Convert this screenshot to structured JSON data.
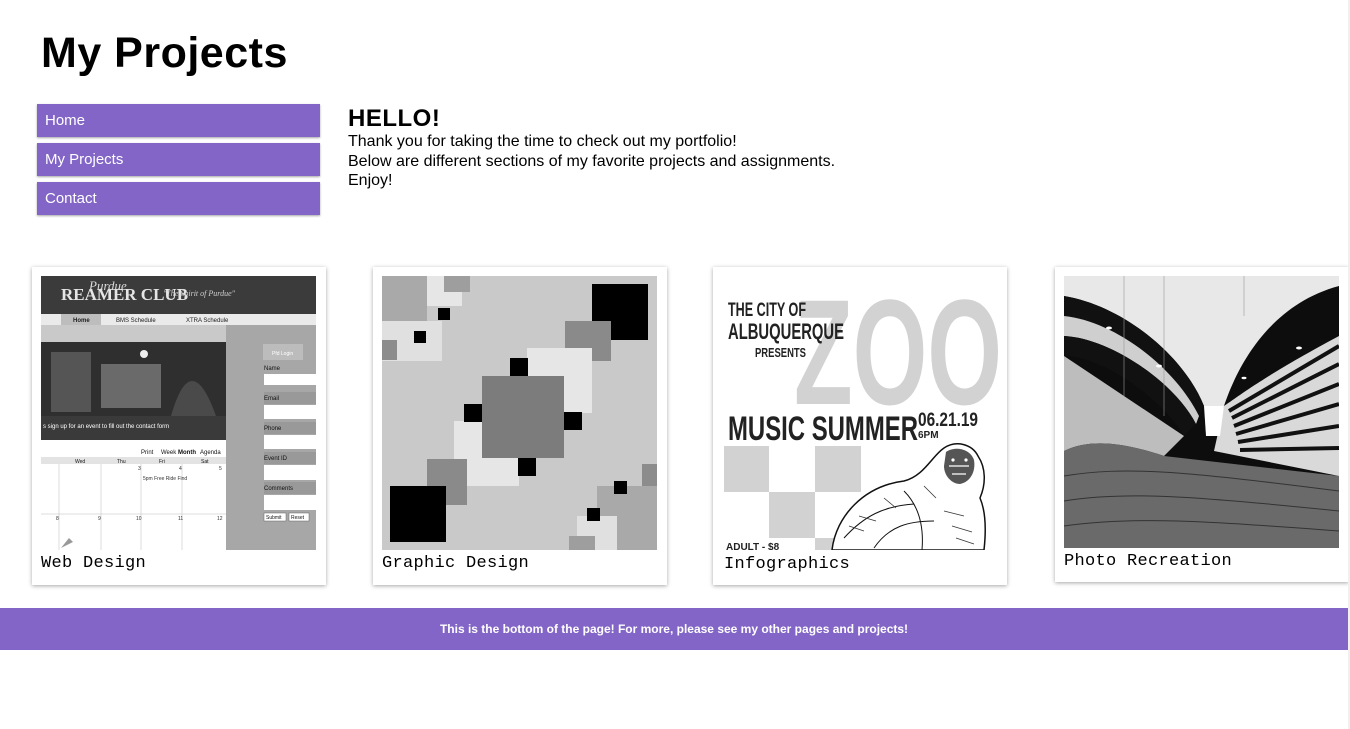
{
  "page": {
    "title": "My Projects"
  },
  "nav": {
    "items": [
      {
        "label": "Home"
      },
      {
        "label": "My Projects"
      },
      {
        "label": "Contact"
      }
    ]
  },
  "intro": {
    "heading": "HELLO!",
    "lines": [
      "Thank you for taking the time to check out my portfolio!",
      "Below are different sections of my favorite projects and assignments.",
      "Enjoy!"
    ]
  },
  "projects": [
    {
      "caption": "Web Design",
      "thumb": {
        "logo": "REAMER CLUB",
        "logo_script": "Purdue",
        "tagline": "\"The Spirit of Purdue\"",
        "tabs": [
          "Home",
          "BMS Schedule",
          "XTRA Schedule"
        ],
        "banner_text": "s sign up for an event to fill out the contact form",
        "form_button": "Pfd Login",
        "form_fields": [
          "Name",
          "Email",
          "Phone",
          "Event ID",
          "Comments"
        ],
        "form_actions": [
          "Submit",
          "Reset"
        ],
        "calendar_views": [
          "Print",
          "Week",
          "Month",
          "Agenda"
        ],
        "calendar_days": [
          "Wed",
          "Thu",
          "Fri",
          "Sat"
        ],
        "calendar_numbers_row1": [
          "3",
          "4",
          "5"
        ],
        "calendar_numbers_row2": [
          "8",
          "9",
          "10",
          "11",
          "12"
        ],
        "calendar_entry": "5pm Free Ride Find"
      }
    },
    {
      "caption": "Graphic Design"
    },
    {
      "caption": "Infographics",
      "thumb": {
        "city_line1": "THE CITY OF",
        "city_line2": "ALBUQUERQUE",
        "presents": "PRESENTS",
        "big_word": "ZOO",
        "event": "MUSIC SUMMER",
        "date": "06.21.19",
        "time": "6PM",
        "admission": "ADULT - $8"
      }
    },
    {
      "caption": "Photo Recreation"
    }
  ],
  "footer": {
    "text": "This is the bottom of the page! For more, please see my other pages and projects!"
  },
  "colors": {
    "accent": "#8265c6",
    "background": "#ffffff"
  },
  "icons": [
    "gorilla-illustration"
  ]
}
